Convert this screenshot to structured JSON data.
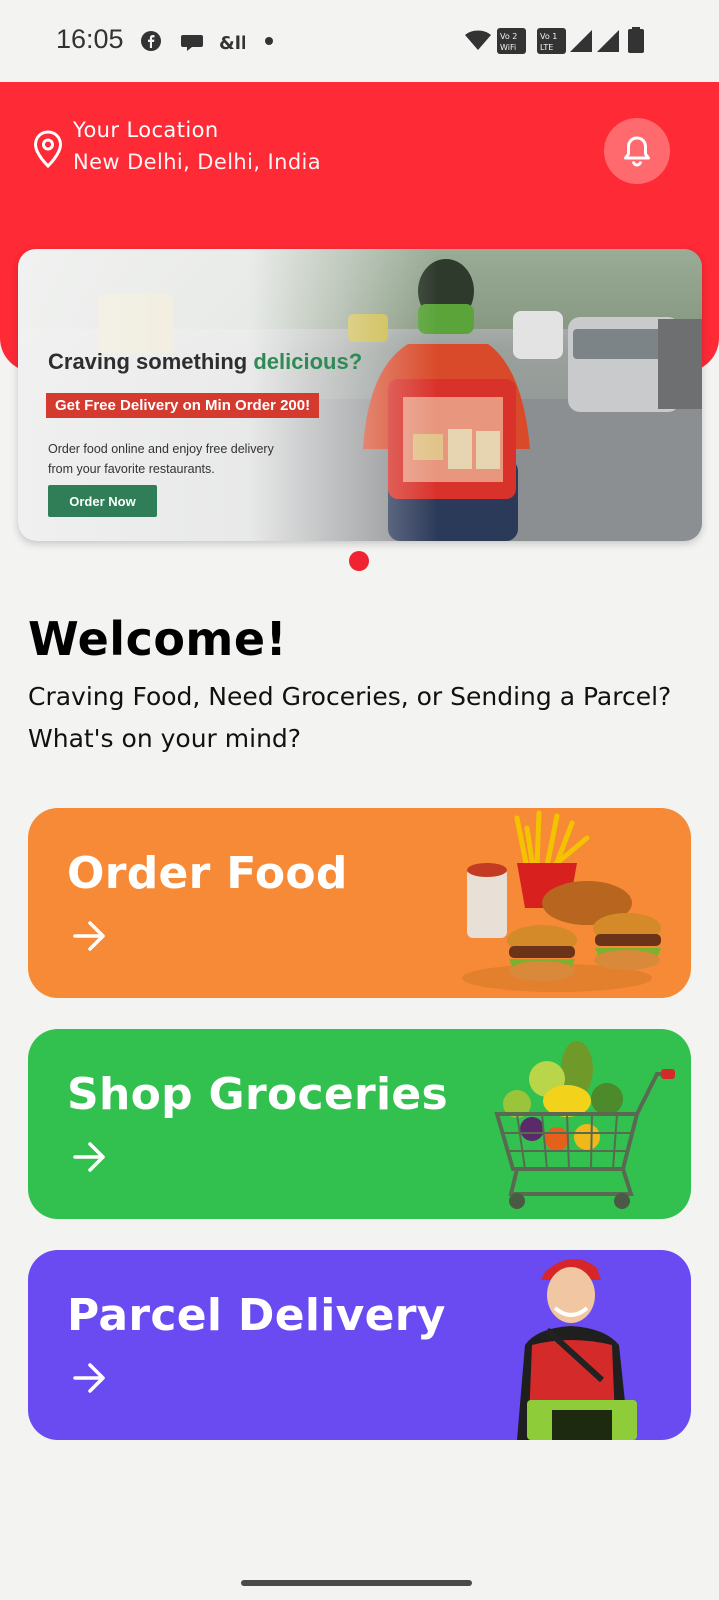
{
  "status_bar": {
    "time": "16:05",
    "icons": [
      "facebook-icon",
      "chat-icon",
      "app-icon",
      "dot-icon",
      "wifi-icon",
      "vowifi-icon",
      "volte-icon",
      "signal-icon",
      "signal-icon",
      "battery-icon"
    ],
    "vowifi_text": "Vo 2 WiFi",
    "volte_text": "Vo 1 LTE"
  },
  "header": {
    "location_label": "Your Location",
    "location_value": "New Delhi, Delhi, India",
    "notification_icon": "bell-icon",
    "background_color": "#fe2a36"
  },
  "banner": {
    "title_part1": "Craving something ",
    "title_accent": "delicious?",
    "promo": "Get Free Delivery on Min Order 200!",
    "description": "Order food online and enjoy free delivery from your favorite restaurants.",
    "button_label": "Order Now",
    "active_slide": 1,
    "total_slides": 1
  },
  "welcome": {
    "heading": "Welcome!",
    "subtitle": "Craving Food, Need Groceries, or Sending a Parcel?  What's on your mind?"
  },
  "cards": [
    {
      "title": "Order Food",
      "icon": "arrow-right-icon",
      "color": "#f78a36"
    },
    {
      "title": "Shop Groceries",
      "icon": "arrow-right-icon",
      "color": "#32c14f"
    },
    {
      "title": "Parcel Delivery",
      "icon": "arrow-right-icon",
      "color": "#6a4bf1"
    }
  ]
}
